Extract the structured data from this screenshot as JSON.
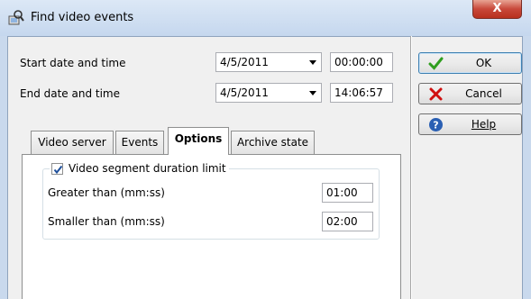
{
  "window": {
    "title": "Find video events",
    "close_label": "X"
  },
  "form": {
    "start_label": "Start date and time",
    "start_date": "4/5/2011",
    "start_time": "00:00:00",
    "end_label": "End date and time",
    "end_date": "4/5/2011",
    "end_time": "14:06:57"
  },
  "tabs": [
    "Video server",
    "Events",
    "Options",
    "Archive state"
  ],
  "active_tab": "Options",
  "options": {
    "limit_label": "Video segment duration limit",
    "limit_checked": true,
    "greater_label": "Greater than (mm:ss)",
    "greater_value": "01:00",
    "smaller_label": "Smaller than (mm:ss)",
    "smaller_value": "02:00"
  },
  "buttons": {
    "ok": "OK",
    "cancel": "Cancel",
    "help": "Help"
  },
  "icons": {
    "title": "find-video-icon",
    "ok": "checkmark-icon",
    "cancel": "red-x-icon",
    "help": "question-icon"
  },
  "colors": {
    "ok_check": "#2f9e1f",
    "cancel_x": "#d01010",
    "help_circle": "#2a5fb3"
  }
}
